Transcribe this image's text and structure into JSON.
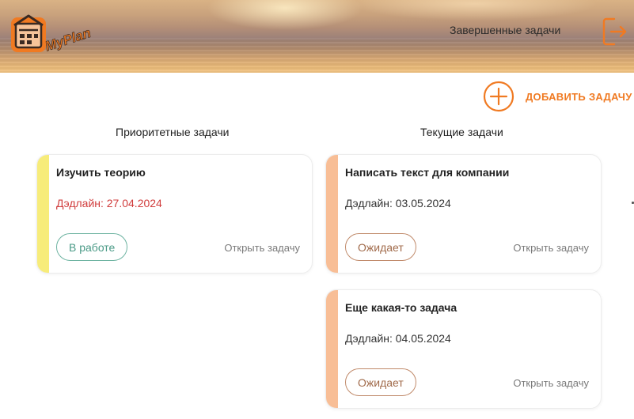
{
  "header": {
    "logo_text": "MyPlan",
    "completed_tasks_link": "Завершенные задачи",
    "exit_icon": "logout-icon"
  },
  "actions": {
    "add_task_label": "ДОБАВИТЬ ЗАДАЧУ",
    "add_icon": "plus-circle-icon"
  },
  "columns": {
    "priority_title": "Приоритетные задачи",
    "current_title": "Текущие задачи"
  },
  "cards": [
    {
      "title": "Изучить теорию",
      "deadline": "Дэдлайн: 27.04.2024",
      "status": "В работе",
      "open_label": "Открыть задачу",
      "stripe_color": "#f7ec7a"
    },
    {
      "title": "Написать текст для компании",
      "deadline": "Дэдлайн: 03.05.2024",
      "status": "Ожидает",
      "open_label": "Открыть задачу",
      "stripe_color": "#f8be96"
    },
    {
      "title": "Еще какая-то задача",
      "deadline": "Дэдлайн: 04.05.2024",
      "status": "Ожидает",
      "open_label": "Открыть задачу",
      "stripe_color": "#f8be96"
    }
  ],
  "colors": {
    "accent": "#f07a22",
    "overdue": "#d03b3b",
    "status_in_progress": "#4a9a86",
    "status_waiting": "#a06a4a"
  }
}
